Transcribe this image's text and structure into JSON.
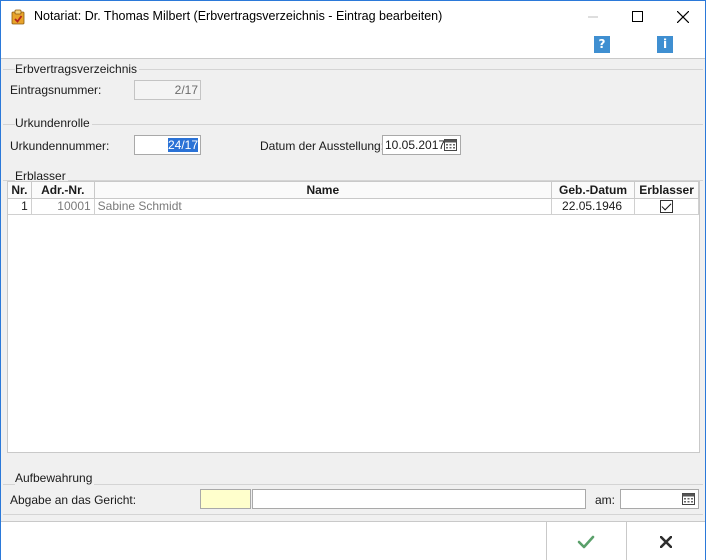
{
  "window": {
    "title": "Notariat: Dr. Thomas Milbert (Erbvertragsverzeichnis - Eintrag bearbeiten)"
  },
  "toolbar": {
    "help_icon": "question-icon",
    "info_icon": "info-icon"
  },
  "section_erbvertrag": {
    "title": "Erbvertragsverzeichnis",
    "eintragsnummer_label": "Eintragsnummer:",
    "eintragsnummer_value": "2/17"
  },
  "section_urkundenrolle": {
    "title": "Urkundenrolle",
    "urkundennummer_label": "Urkundennummer:",
    "urkundennummer_value": "24/17",
    "datum_label": "Datum der Ausstellung:",
    "datum_value": "10.05.2017"
  },
  "section_erblasser": {
    "title": "Erblasser",
    "columns": [
      "Nr.",
      "Adr.-Nr.",
      "Name",
      "Geb.-Datum",
      "Erblasser"
    ],
    "rows": [
      {
        "nr": "1",
        "adr": "10001",
        "name": "Sabine Schmidt",
        "geb": "22.05.1946",
        "erblasser": true
      }
    ]
  },
  "section_aufbewahrung": {
    "title": "Aufbewahrung",
    "abgabe_label": "Abgabe an das Gericht:",
    "am_label": "am:",
    "gericht_code": "",
    "gericht_name": "",
    "am_value": ""
  },
  "colors": {
    "accent": "#2b79d9",
    "ok_green": "#5aa06a",
    "cancel_dark": "#2e2e2e",
    "highlight_yellow": "#ffffcc"
  }
}
